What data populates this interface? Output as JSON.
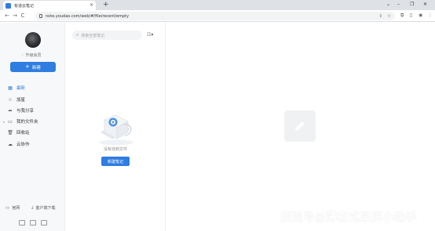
{
  "browser": {
    "tab_title": "有道云笔记",
    "tab_close": "×",
    "new_tab": "+",
    "url": "note.youdao.com/web/#/file/recent/empty",
    "window_controls": [
      "⌄",
      "–",
      "❐",
      "✕"
    ],
    "nav": [
      "←",
      "→",
      "C"
    ],
    "omnibox_icons": [
      "share-icon",
      "star-icon"
    ],
    "toolbar_icons": [
      "extension-icon",
      "sidepanel-icon",
      "profile-icon",
      "menu-icon"
    ]
  },
  "sidebar": {
    "upgrade": "升级会员",
    "new_button": "新建",
    "items": [
      {
        "label": "最新",
        "icon": "grid-icon",
        "active": true
      },
      {
        "label": "加星",
        "icon": "star-icon",
        "active": false
      },
      {
        "label": "与我分享",
        "icon": "share-icon",
        "active": false
      },
      {
        "label": "我的文件夹",
        "icon": "folder-icon",
        "active": false
      },
      {
        "label": "回收站",
        "icon": "trash-icon",
        "active": false
      },
      {
        "label": "云协作",
        "icon": "cloud-icon",
        "active": false
      }
    ],
    "bottom": {
      "website": "官网",
      "download": "客户端下载"
    }
  },
  "list": {
    "search_placeholder": "搜索全部笔记",
    "empty_text": "没有找到文件",
    "new_note": "新建笔记"
  },
  "watermark": "搜狐号@薄格式录屏小助手",
  "colors": {
    "accent": "#2f7de1",
    "sidebar_bg": "#f7f8fa"
  }
}
